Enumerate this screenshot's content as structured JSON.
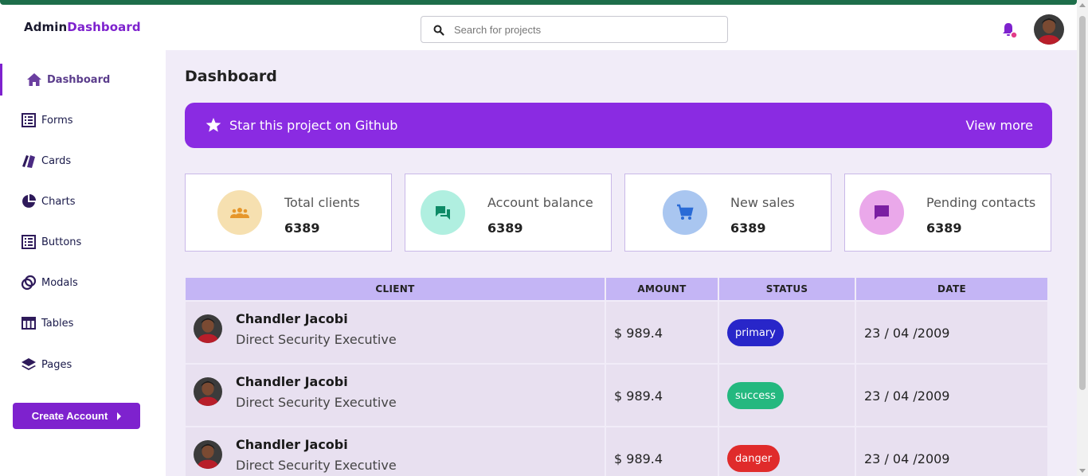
{
  "brand": {
    "part1": "Admin",
    "part2": "Dashboard"
  },
  "search": {
    "placeholder": "Search for projects"
  },
  "sidebar": {
    "items": [
      {
        "label": "Dashboard",
        "icon": "home-icon",
        "active": true
      },
      {
        "label": "Forms",
        "icon": "form-list-icon"
      },
      {
        "label": "Cards",
        "icon": "cards-icon"
      },
      {
        "label": "Charts",
        "icon": "pie-chart-icon"
      },
      {
        "label": "Buttons",
        "icon": "button-list-icon"
      },
      {
        "label": "Modals",
        "icon": "modals-icon"
      },
      {
        "label": "Tables",
        "icon": "table-icon"
      },
      {
        "label": "Pages",
        "icon": "layers-icon"
      }
    ],
    "create_label": "Create Account"
  },
  "main": {
    "title": "Dashboard",
    "banner": {
      "text": "Star this project on Github",
      "link": "View more"
    },
    "cards": [
      {
        "label": "Total clients",
        "value": "6389",
        "icon": "group-icon",
        "color": "#f6e0b0",
        "icon_color": "#e6962a"
      },
      {
        "label": "Account balance",
        "value": "6389",
        "icon": "chat-icon",
        "color": "#b0efe0",
        "icon_color": "#0e8a66"
      },
      {
        "label": "New sales",
        "value": "6389",
        "icon": "cart-icon",
        "color": "#a9c6f0",
        "icon_color": "#2a6bd6"
      },
      {
        "label": "Pending contacts",
        "value": "6389",
        "icon": "message-icon",
        "color": "#eaa8ea",
        "icon_color": "#7b1fa2"
      }
    ],
    "table": {
      "headers": [
        "CLIENT",
        "AMOUNT",
        "STATUS",
        "DATE"
      ],
      "rows": [
        {
          "name": "Chandler Jacobi",
          "title": "Direct Security Executive",
          "amount": "$ 989.4",
          "status": "primary",
          "status_color": "#2826c9",
          "date": "23 / 04 /2009"
        },
        {
          "name": "Chandler Jacobi",
          "title": "Direct Security Executive",
          "amount": "$ 989.4",
          "status": "success",
          "status_color": "#24b87f",
          "date": "23 / 04 /2009"
        },
        {
          "name": "Chandler Jacobi",
          "title": "Direct Security Executive",
          "amount": "$ 989.4",
          "status": "danger",
          "status_color": "#e02b2b",
          "date": "23 / 04 /2009"
        }
      ]
    }
  },
  "colors": {
    "accent": "#7e22ce",
    "banner": "#8a2be2",
    "background": "#f1ecf8"
  }
}
